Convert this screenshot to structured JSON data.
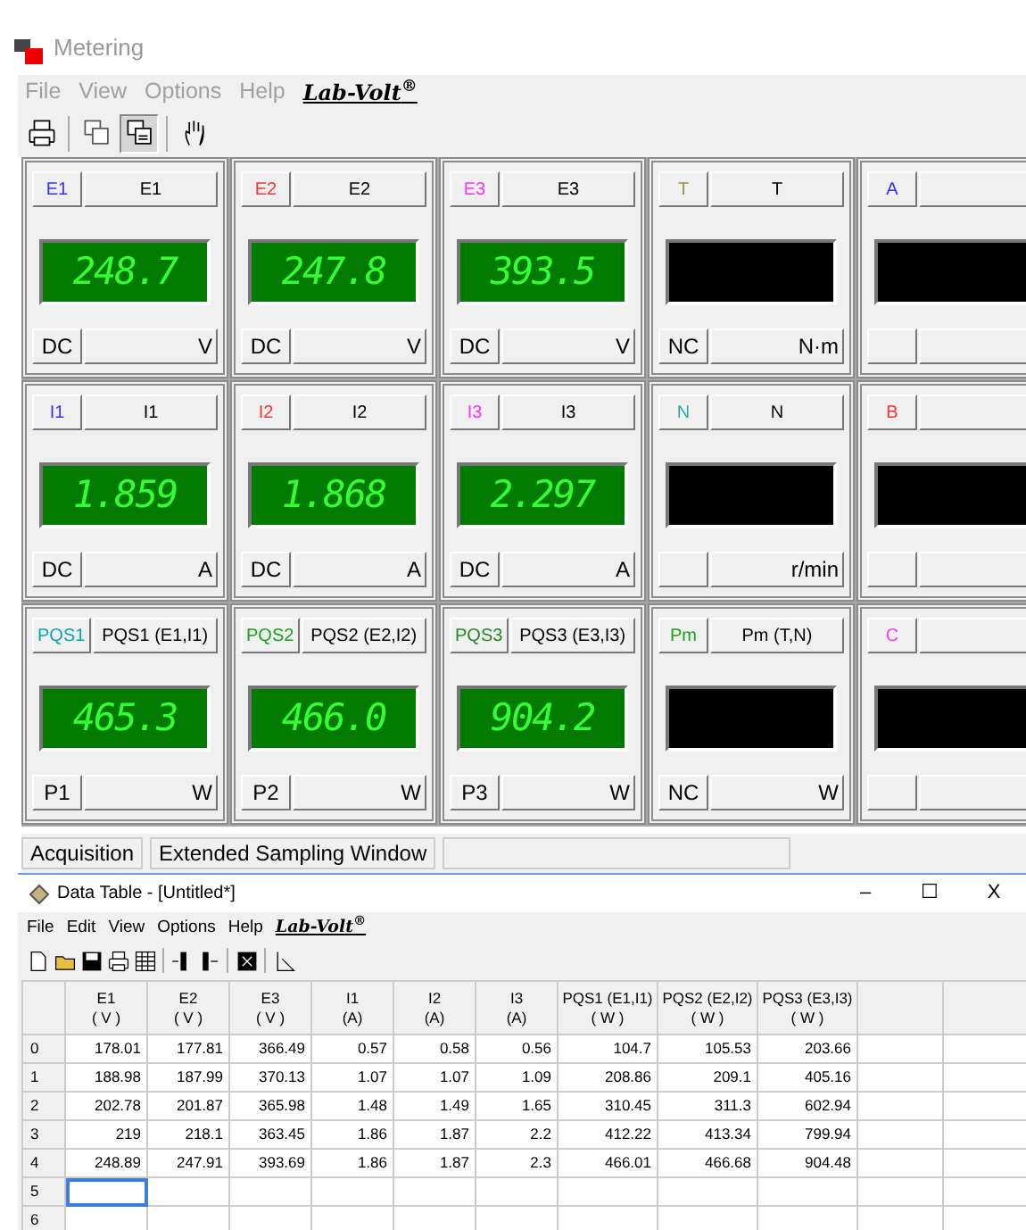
{
  "window": {
    "title": "Metering"
  },
  "menu": [
    "File",
    "View",
    "Options",
    "Help"
  ],
  "logo": "Lab-Volt$^{®}$",
  "toolbar": [
    {
      "kind": "print",
      "pressed": false
    },
    {
      "kind": "separator"
    },
    {
      "kind": "copy",
      "pressed": false
    },
    {
      "kind": "copy-all",
      "pressed": true
    },
    {
      "kind": "separator"
    },
    {
      "kind": "hand",
      "pressed": false
    }
  ],
  "meter_rows": [
    [
      {
        "code": "E1",
        "color": "#3333ff",
        "name": "E1",
        "reading": "248.7",
        "mode": "DC",
        "unit": "V"
      },
      {
        "code": "E2",
        "color": "#ff3333",
        "name": "E2",
        "reading": "247.8",
        "mode": "DC",
        "unit": "V"
      },
      {
        "code": "E3",
        "color": "#ff33ff",
        "name": "E3",
        "reading": "393.5",
        "mode": "DC",
        "unit": "V"
      },
      {
        "code": "T",
        "color": "#a09040",
        "name": "T",
        "mode": "NC",
        "unit": "N·m"
      },
      {
        "code": "A",
        "color": "#3333ff"
      }
    ],
    [
      {
        "code": "I1",
        "color": "#3333ff",
        "name": "I1",
        "reading": "1.859",
        "mode": "DC",
        "unit": "A"
      },
      {
        "code": "I2",
        "color": "#ff3333",
        "name": "I2",
        "reading": "1.868",
        "mode": "DC",
        "unit": "A"
      },
      {
        "code": "I3",
        "color": "#ff33ff",
        "name": "I3",
        "reading": "2.297",
        "mode": "DC",
        "unit": "A"
      },
      {
        "code": "N",
        "color": "#33aaaa",
        "name": "N",
        "unit": "r/min"
      },
      {
        "code": "B",
        "color": "#ff3333"
      }
    ],
    [
      {
        "code": "PQS1",
        "color": "#0aa5b5",
        "name": "PQS1 (E1,I1)",
        "reading": "465.3",
        "mode": "P1",
        "unit": "W"
      },
      {
        "code": "PQS2",
        "color": "#1fa01f",
        "name": "PQS2 (E2,I2)",
        "reading": "466.0",
        "mode": "P2",
        "unit": "W"
      },
      {
        "code": "PQS3",
        "color": "#2a862a",
        "name": "PQS3 (E3,I3)",
        "reading": "904.2",
        "mode": "P3",
        "unit": "W"
      },
      {
        "code": "Pm",
        "color": "#1fa01f",
        "name": "Pm (T,N)",
        "mode": "NC",
        "unit": "W"
      },
      {
        "code": "C",
        "color": "#ff33ff"
      }
    ]
  ],
  "status_bar": [
    "Acquisition",
    "Extended Sampling Window"
  ],
  "data_table": {
    "title": "Data Table - [Untitled*]",
    "window_controls": [
      "–",
      "☐",
      "X"
    ],
    "menu": [
      "File",
      "Edit",
      "View",
      "Options",
      "Help"
    ],
    "logo": "Lab-Volt$^{®}$",
    "toolbar": [
      {
        "kind": "new"
      },
      {
        "kind": "open"
      },
      {
        "kind": "save"
      },
      {
        "kind": "print"
      },
      {
        "kind": "table"
      },
      {
        "kind": "separator"
      },
      {
        "kind": "column"
      },
      {
        "kind": "row"
      },
      {
        "kind": "separator"
      },
      {
        "kind": "grid"
      },
      {
        "kind": "separator"
      },
      {
        "kind": "graph"
      }
    ],
    "columns": [
      {
        "name": "E1",
        "unit": "( V )"
      },
      {
        "name": "E2",
        "unit": "( V )"
      },
      {
        "name": "E3",
        "unit": "( V )"
      },
      {
        "name": "I1",
        "unit": "(A)"
      },
      {
        "name": "I2",
        "unit": "(A)"
      },
      {
        "name": "I3",
        "unit": "(A)"
      },
      {
        "name": "PQS1 (E1,I1)",
        "unit": "( W )"
      },
      {
        "name": "PQS2 (E2,I2)",
        "unit": "( W )"
      },
      {
        "name": "PQS3 (E3,I3)",
        "unit": "( W )"
      }
    ],
    "rows": [
      {
        "label": "0",
        "cursor": false,
        "cells": [
          "178.01",
          "177.81",
          "366.49",
          "0.57",
          "0.58",
          "0.56",
          "104.7",
          "105.53",
          "203.66"
        ]
      },
      {
        "label": "1",
        "cursor": false,
        "cells": [
          "188.98",
          "187.99",
          "370.13",
          "1.07",
          "1.07",
          "1.09",
          "208.86",
          "209.1",
          "405.16"
        ]
      },
      {
        "label": "2",
        "cursor": false,
        "cells": [
          "202.78",
          "201.87",
          "365.98",
          "1.48",
          "1.49",
          "1.65",
          "310.45",
          "311.3",
          "602.94"
        ]
      },
      {
        "label": "3",
        "cursor": false,
        "cells": [
          "219",
          "218.1",
          "363.45",
          "1.86",
          "1.87",
          "2.2",
          "412.22",
          "413.34",
          "799.94"
        ]
      },
      {
        "label": "4",
        "cursor": false,
        "cells": [
          "248.89",
          "247.91",
          "393.69",
          "1.86",
          "1.87",
          "2.3",
          "466.01",
          "466.68",
          "904.48"
        ]
      },
      {
        "label": "5",
        "cursor": true,
        "cells": []
      },
      {
        "label": "6",
        "cursor": false,
        "cells": []
      }
    ]
  }
}
